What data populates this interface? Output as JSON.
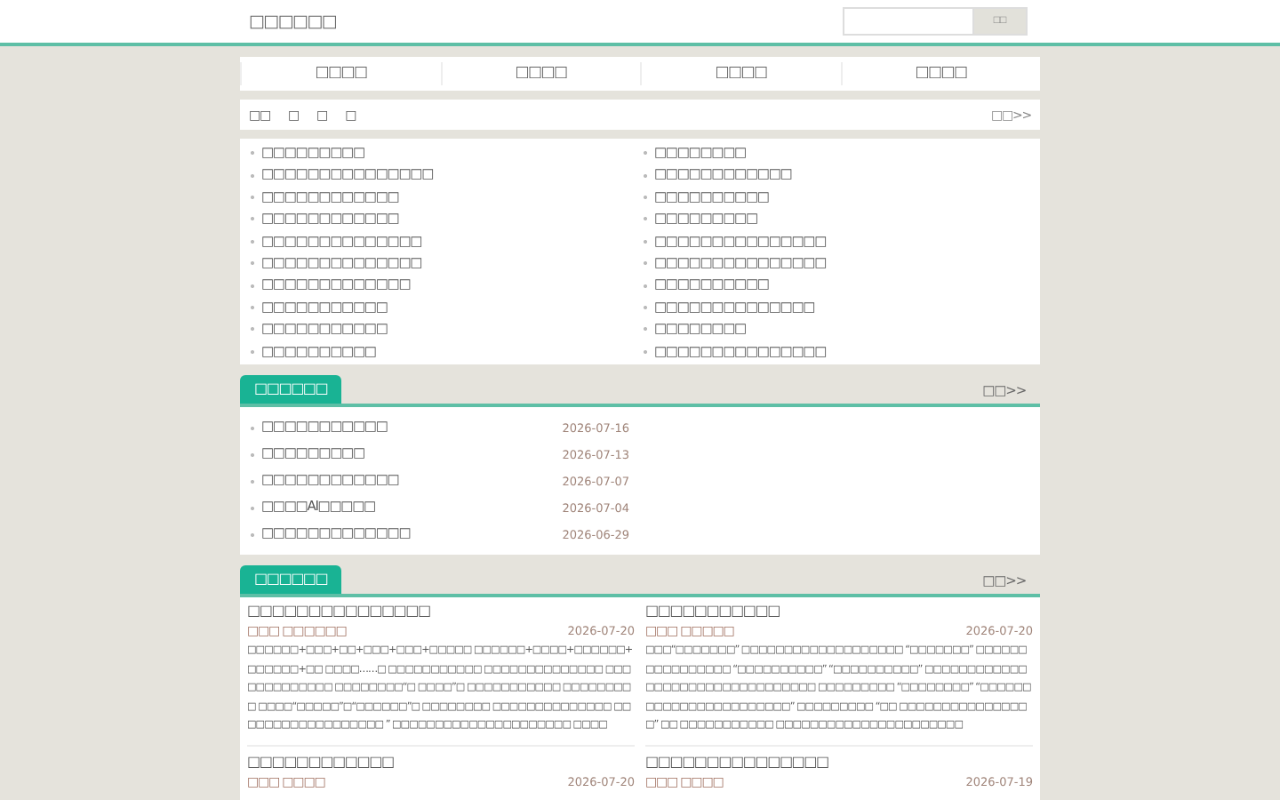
{
  "header": {
    "title": "□□□□□□",
    "search": {
      "button": "□□"
    }
  },
  "nav": [
    {
      "label": "□□□□"
    },
    {
      "label": "□□□□"
    },
    {
      "label": "□□□□"
    },
    {
      "label": "□□□□"
    }
  ],
  "sub_bar": {
    "items": [
      "□□",
      "□",
      "□",
      "□"
    ],
    "more": "□□>>"
  },
  "links": [
    [
      "□□□□□□□□□",
      "□□□□□□□□□□□□□□□",
      "□□□□□□□□□□□□",
      "□□□□□□□□□□□□",
      "□□□□□□□□□□□□□□",
      "□□□□□□□□□□□□□□",
      "□□□□□□□□□□□□□",
      "□□□□□□□□□□□",
      "□□□□□□□□□□□",
      "□□□□□□□□□□"
    ],
    [
      "□□□□□□□□",
      "□□□□□□□□□□□□",
      "□□□□□□□□□□",
      "□□□□□□□□□",
      "□□□□□□□□□□□□□□□",
      "□□□□□□□□□□□□□□□",
      "□□□□□□□□□□",
      "□□□□□□□□□□□□□□",
      "□□□□□□□□",
      "□□□□□□□□□□□□□□□"
    ]
  ],
  "latest": {
    "title": "□□□□□□",
    "more": "□□>>",
    "items": [
      {
        "title": "□□□□□□□□□□□",
        "date": "2026-07-16"
      },
      {
        "title": "□□□□□□□□□",
        "date": "2026-07-13"
      },
      {
        "title": "□□□□□□□□□□□□",
        "date": "2026-07-07"
      },
      {
        "title": "□□□□AI□□□□□",
        "date": "2026-07-04"
      },
      {
        "title": "□□□□□□□□□□□□□",
        "date": "2026-06-29"
      }
    ]
  },
  "articles": {
    "title": "□□□□□□",
    "more": "□□>>",
    "items": [
      {
        "title": "□□□□□□□□□□□□□□□",
        "author": "□□□ □□□□□□",
        "date": "2026-07-20",
        "summary": "□□□□□□+□□□+□□+□□□+□□□+□□□□□ □□□□□□+□□□□+□□□□□□+□□□□□□+□□ □□□□……□ □□□□□□□□□□□ □□□□□□□□□□□□□□ □□□□□□□□□□□□□ □□□□□□□□“□ □□□□”□ □□□□□□□□□□□ □□□□□□□□□ □□□□“□□□□□”□“□□□□□□”□ □□□□□□□□ □□□□□□□□□□□□□□ □□□□□□□□□□□□□□□□□□ ” □□□□□□□□□□□□□□□□□□□□□ □□□□"
      },
      {
        "title": "□□□□□□□□□□□",
        "author": "□□□ □□□□□",
        "date": "2026-07-20",
        "summary": "□□□“□□□□□□□” □□□□□□□□□□□□□□□□□□□ “□□□□□□□” □□□□□□□□□□□□□□□□ “□□□□□□□□□□” “□□□□□□□□□□” □□□□□□□□□□□□□□□□□□□□□□□□□□□□□□□□ □□□□□□□□□ “□□□□□□□□” “□□□□□□□□□□□□□□□□□□□□□□□” □□□□□□□□□ “□□ □□□□□□□□□□□□□□□□” □□ □□□□□□□□□□□ □□□□□□□□□□□□□□□□□□□□□□"
      },
      {
        "title": "□□□□□□□□□□□□",
        "author": "□□□ □□□□",
        "date": "2026-07-20"
      },
      {
        "title": "□□□□□□□□□□□□□□□",
        "author": "□□□ □□□□",
        "date": "2026-07-19"
      }
    ]
  }
}
